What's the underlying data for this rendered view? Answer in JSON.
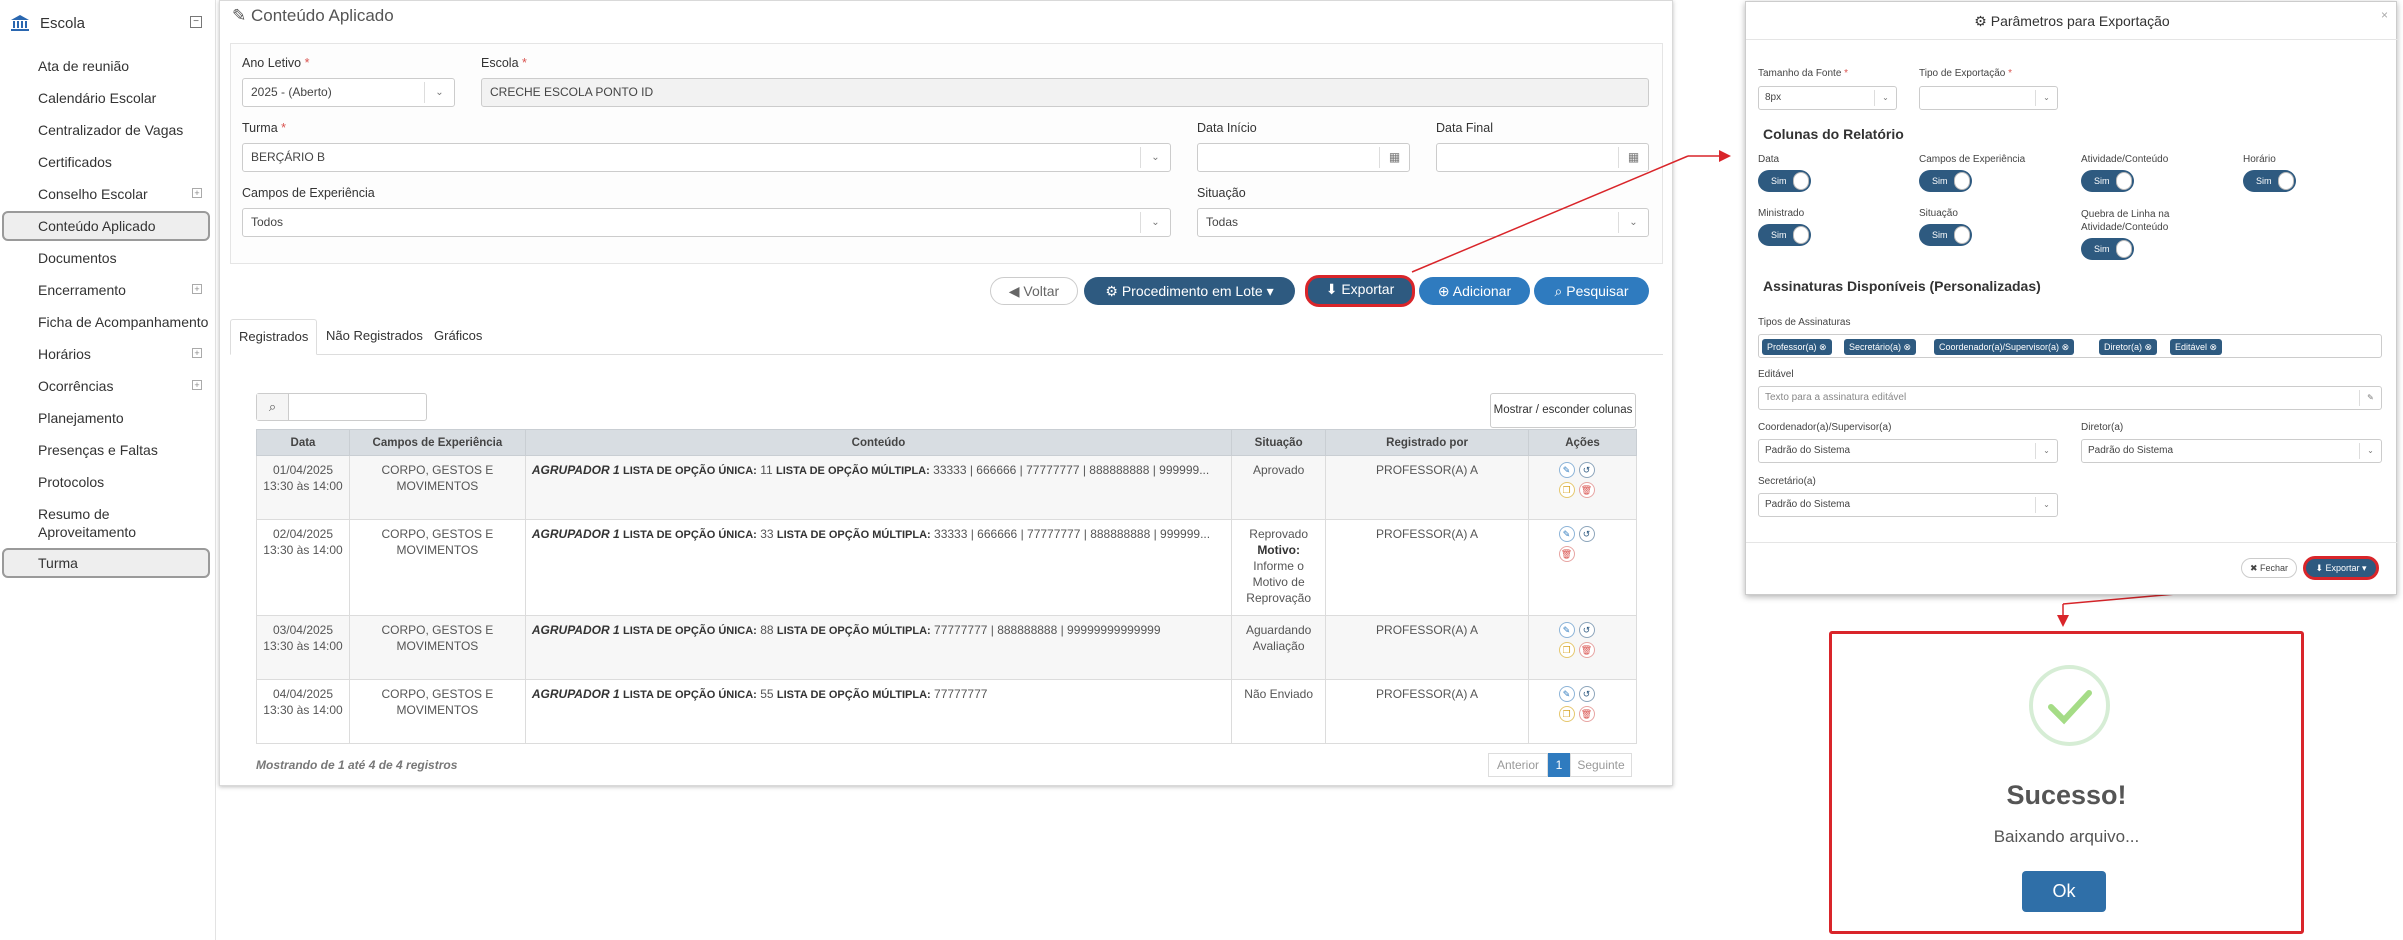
{
  "sidebar": {
    "header": "Escola",
    "items": [
      {
        "label": "Ata de reunião"
      },
      {
        "label": "Calendário Escolar"
      },
      {
        "label": "Centralizador de Vagas"
      },
      {
        "label": "Certificados"
      },
      {
        "label": "Conselho Escolar",
        "expand": "+"
      },
      {
        "label": "Conteúdo Aplicado"
      },
      {
        "label": "Documentos"
      },
      {
        "label": "Encerramento",
        "expand": "+"
      },
      {
        "label": "Ficha de Acompanhamento"
      },
      {
        "label": "Horários",
        "expand": "+"
      },
      {
        "label": "Ocorrências",
        "expand": "+"
      },
      {
        "label": "Planejamento"
      },
      {
        "label": "Presenças e Faltas"
      },
      {
        "label": "Protocolos"
      },
      {
        "label": "Resumo de Aproveitamento"
      },
      {
        "label": "Turma"
      }
    ]
  },
  "main": {
    "title": "Conteúdo Aplicado",
    "filters": {
      "ano_label": "Ano Letivo",
      "ano_value": "2025 - (Aberto)",
      "escola_label": "Escola",
      "escola_value": "CRECHE ESCOLA PONTO ID",
      "turma_label": "Turma",
      "turma_value": "BERÇÁRIO B",
      "data_inicio_label": "Data Início",
      "data_final_label": "Data Final",
      "campos_label": "Campos de Experiência",
      "campos_value": "Todos",
      "situacao_label": "Situação",
      "situacao_value": "Todas",
      "required_mark": "*"
    },
    "buttons": {
      "voltar": "Voltar",
      "lote": "Procedimento em Lote",
      "exportar": "Exportar",
      "adicionar": "Adicionar",
      "pesquisar": "Pesquisar"
    },
    "tabs": [
      "Registrados",
      "Não Registrados",
      "Gráficos"
    ],
    "toggle_columns": "Mostrar / esconder colunas",
    "table": {
      "headers": [
        "Data",
        "Campos de Experiência",
        "Conteúdo",
        "Situação",
        "Registrado por",
        "Ações"
      ],
      "rows": [
        {
          "date": "01/04/2025",
          "time": "13:30 às 14:00",
          "campo": "CORPO, GESTOS E MOVIMENTOS",
          "agr": "AGRUPADOR 1",
          "unica_label": "LISTA DE OPÇÃO ÚNICA:",
          "unica_val": "11",
          "multi_label": "LISTA DE OPÇÃO MÚLTIPLA:",
          "multi_val": "33333 | 666666 | 77777777 | 888888888 | 999999...",
          "situacao": "Aprovado",
          "motivo_label": "",
          "motivo": "",
          "por": "PROFESSOR(A) A"
        },
        {
          "date": "02/04/2025",
          "time": "13:30 às 14:00",
          "campo": "CORPO, GESTOS E MOVIMENTOS",
          "agr": "AGRUPADOR 1",
          "unica_label": "LISTA DE OPÇÃO ÚNICA:",
          "unica_val": "33",
          "multi_label": "LISTA DE OPÇÃO MÚLTIPLA:",
          "multi_val": "33333 | 666666 | 77777777 | 888888888 | 999999...",
          "situacao": "Reprovado",
          "motivo_label": "Motivo:",
          "motivo": "Informe o Motivo de Reprovação",
          "por": "PROFESSOR(A) A"
        },
        {
          "date": "03/04/2025",
          "time": "13:30 às 14:00",
          "campo": "CORPO, GESTOS E MOVIMENTOS",
          "agr": "AGRUPADOR 1",
          "unica_label": "LISTA DE OPÇÃO ÚNICA:",
          "unica_val": "88",
          "multi_label": "LISTA DE OPÇÃO MÚLTIPLA:",
          "multi_val": "77777777 | 888888888 | 99999999999999",
          "situacao": "Aguardando Avaliação",
          "motivo_label": "",
          "motivo": "",
          "por": "PROFESSOR(A) A"
        },
        {
          "date": "04/04/2025",
          "time": "13:30 às 14:00",
          "campo": "CORPO, GESTOS E MOVIMENTOS",
          "agr": "AGRUPADOR 1",
          "unica_label": "LISTA DE OPÇÃO ÚNICA:",
          "unica_val": "55",
          "multi_label": "LISTA DE OPÇÃO MÚLTIPLA:",
          "multi_val": "77777777",
          "situacao": "Não Enviado",
          "motivo_label": "",
          "motivo": "",
          "por": "PROFESSOR(A) A"
        }
      ]
    },
    "footer_text": "Mostrando de 1 até 4 de 4 registros",
    "pagination": {
      "prev": "Anterior",
      "page": "1",
      "next": "Seguinte"
    }
  },
  "dialog": {
    "title": "Parâmetros para Exportação",
    "close": "×",
    "fonte_label": "Tamanho da Fonte",
    "fonte_value": "8px",
    "tipo_label": "Tipo de Exportação",
    "tipo_value": "",
    "colunas_title": "Colunas do Relatório",
    "toggles": [
      {
        "label": "Data",
        "value": "Sim"
      },
      {
        "label": "Campos de Experiência",
        "value": "Sim"
      },
      {
        "label": "Atividade/Conteúdo",
        "value": "Sim"
      },
      {
        "label": "Horário",
        "value": "Sim"
      },
      {
        "label": "Ministrado",
        "value": "Sim"
      },
      {
        "label": "Situação",
        "value": "Sim"
      },
      {
        "label": "Quebra de Linha na Atividade/Conteúdo",
        "value": "Sim"
      }
    ],
    "assinaturas_title": "Assinaturas Disponíveis (Personalizadas)",
    "tipos_label": "Tipos de Assinaturas",
    "tags": [
      "Professor(a)",
      "Secretário(a)",
      "Coordenador(a)/Supervisor(a)",
      "Diretor(a)",
      "Editável"
    ],
    "editavel_label": "Editável",
    "editavel_placeholder": "Texto para a assinatura editável",
    "coord_label": "Coordenador(a)/Supervisor(a)",
    "coord_value": "Padrão do Sistema",
    "diretor_label": "Diretor(a)",
    "diretor_value": "Padrão do Sistema",
    "secretario_label": "Secretário(a)",
    "secretario_value": "Padrão do Sistema",
    "fechar": "Fechar",
    "exportar": "Exportar"
  },
  "success": {
    "title": "Sucesso!",
    "text": "Baixando arquivo...",
    "ok": "Ok"
  },
  "colors": {
    "primary": "#2e5a80",
    "accent": "#2f7bbf",
    "highlight": "#d9252a",
    "success": "#a5dc86"
  }
}
